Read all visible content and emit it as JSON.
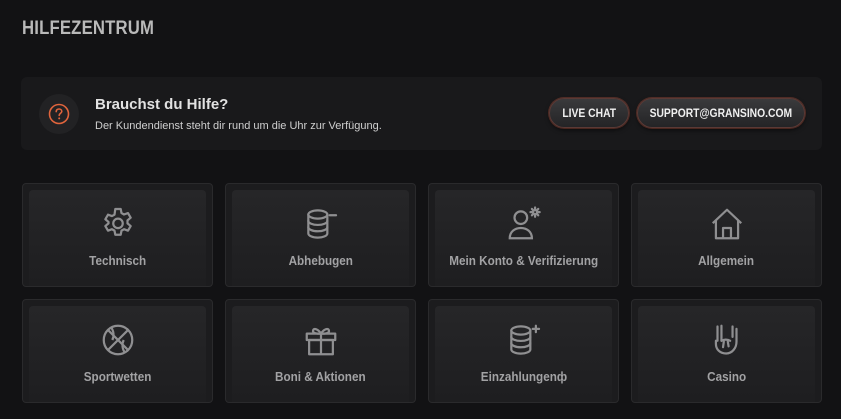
{
  "page": {
    "title": "HILFEZENTRUM"
  },
  "help": {
    "heading": "Brauchst du Hilfe?",
    "subtext": "Der Kundendienst steht dir rund um die Uhr zur Verfügung.",
    "live_chat_label": "LIVE CHAT",
    "email_label": "SUPPORT@GRANSINO.COM",
    "icon": "question-circle-icon",
    "accent_color": "#e0643c"
  },
  "categories": [
    {
      "label": "Technisch",
      "icon": "gear-icon"
    },
    {
      "label": "Abhebugen",
      "icon": "coin-stack-minus-icon"
    },
    {
      "label": "Mein Konto & Verifizierung",
      "icon": "user-settings-icon"
    },
    {
      "label": "Allgemein",
      "icon": "home-icon"
    },
    {
      "label": "Sportwetten",
      "icon": "basketball-icon"
    },
    {
      "label": "Boni & Aktionen",
      "icon": "gift-icon"
    },
    {
      "label": "Einzahlungenф",
      "icon": "coin-stack-plus-icon"
    },
    {
      "label": "Casino",
      "icon": "rock-hand-icon"
    }
  ]
}
